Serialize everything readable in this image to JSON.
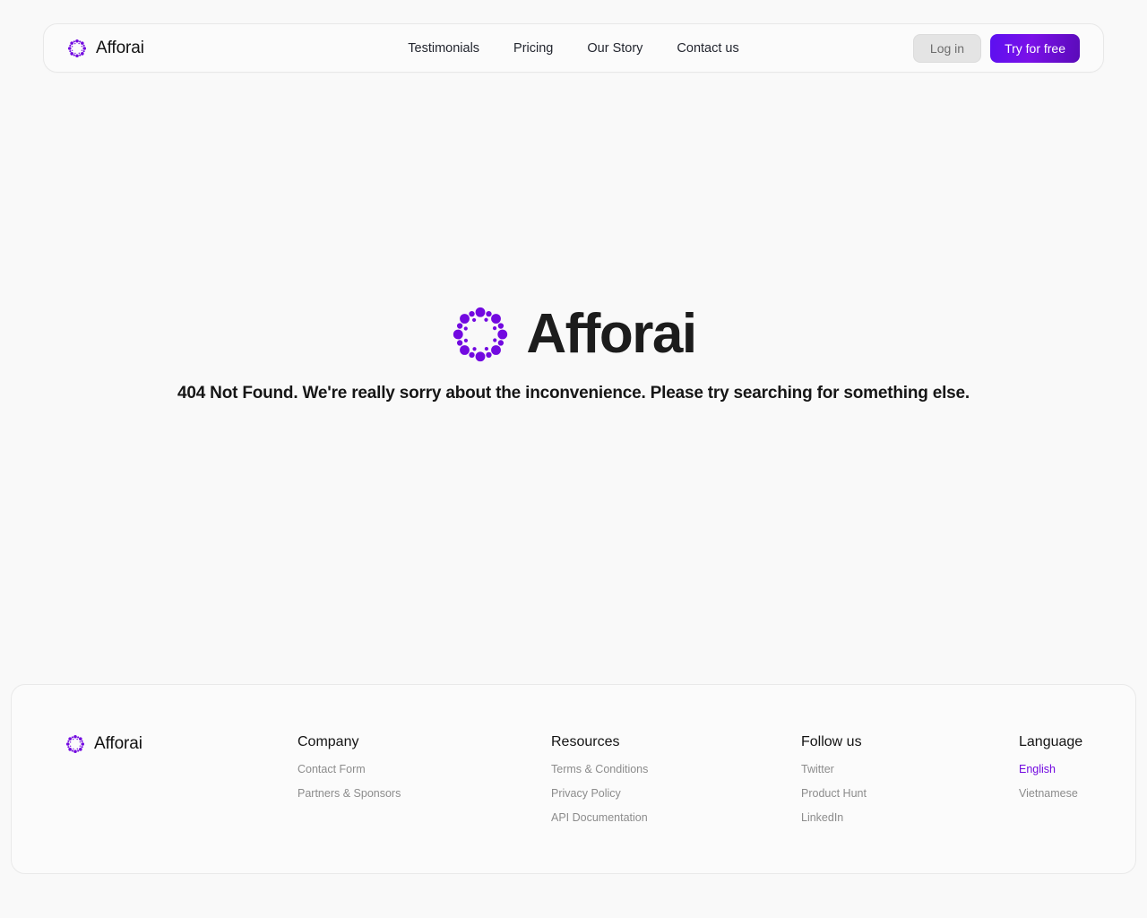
{
  "brand": {
    "name": "Afforai",
    "logo_icon": "afforai-dot-ring-logo",
    "accent_color": "#7209e0"
  },
  "header": {
    "nav": [
      {
        "label": "Testimonials"
      },
      {
        "label": "Pricing"
      },
      {
        "label": "Our Story"
      },
      {
        "label": "Contact us"
      }
    ],
    "login_label": "Log in",
    "try_label": "Try for free"
  },
  "hero": {
    "wordmark": "Afforai",
    "message": "404 Not Found. We're really sorry about the inconvenience. Please try searching for something else."
  },
  "footer": {
    "brand_name": "Afforai",
    "columns": [
      {
        "title": "Company",
        "links": [
          {
            "label": "Contact Form",
            "active": false
          },
          {
            "label": "Partners & Sponsors",
            "active": false
          }
        ]
      },
      {
        "title": "Resources",
        "links": [
          {
            "label": "Terms & Conditions",
            "active": false
          },
          {
            "label": "Privacy Policy",
            "active": false
          },
          {
            "label": "API Documentation",
            "active": false
          }
        ]
      },
      {
        "title": "Follow us",
        "links": [
          {
            "label": "Twitter",
            "active": false
          },
          {
            "label": "Product Hunt",
            "active": false
          },
          {
            "label": "LinkedIn",
            "active": false
          }
        ]
      },
      {
        "title": "Language",
        "links": [
          {
            "label": "English",
            "active": true
          },
          {
            "label": "Vietnamese",
            "active": false
          }
        ]
      }
    ]
  }
}
